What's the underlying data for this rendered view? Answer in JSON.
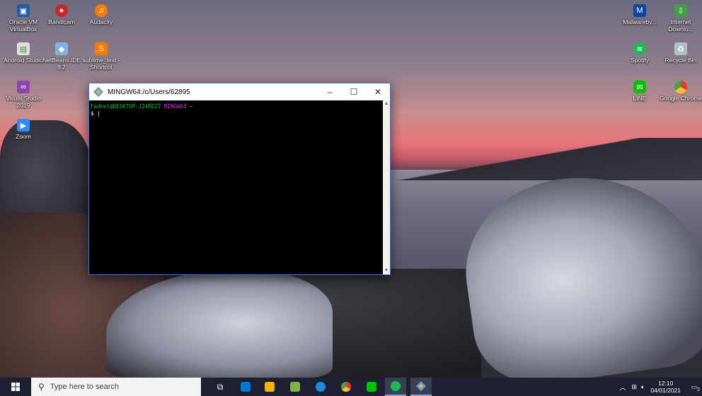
{
  "desktop_icons": [
    {
      "label": "Oracle VM VirtualBox",
      "icon": "virtualbox-icon",
      "color": "#1f5fa8"
    },
    {
      "label": "Bandicam",
      "icon": "bandicam-icon",
      "color": "#c62828"
    },
    {
      "label": "Audacity",
      "icon": "audacity-icon",
      "color": "#f57c00"
    },
    {
      "label": "Android Studio",
      "icon": "android-studio-icon",
      "color": "#e0e0e0"
    },
    {
      "label": "NetBeans IDE 8.2",
      "icon": "netbeans-icon",
      "color": "#7fb2e5"
    },
    {
      "label": "sublime_text - Shortcut",
      "icon": "sublime-icon",
      "color": "#ff7b00"
    },
    {
      "label": "Visual Studio 2019",
      "icon": "visual-studio-icon",
      "color": "#8e44ad"
    },
    {
      "label": "Zoom",
      "icon": "zoom-icon",
      "color": "#2d8cff"
    },
    {
      "label": "Malwareby...",
      "icon": "malwarebytes-icon",
      "color": "#0d47a1"
    },
    {
      "label": "Internet Downlo...",
      "icon": "idm-icon",
      "color": "#43a047"
    },
    {
      "label": "Spotify",
      "icon": "spotify-icon",
      "color": "#1db954"
    },
    {
      "label": "Recycle Bin",
      "icon": "recycle-bin-icon",
      "color": "#b0bec5"
    },
    {
      "label": "LINE",
      "icon": "line-icon",
      "color": "#00c300"
    },
    {
      "label": "Google Chrome",
      "icon": "chrome-icon",
      "color": "#e53935"
    }
  ],
  "terminal": {
    "title": "MINGW64:/c/Users/62895",
    "prompt_user": "Fadhel@DESKTOP-J24RE27",
    "prompt_env": "MINGW64",
    "prompt_path": "~",
    "prompt_symbol": "$",
    "minimize": "–",
    "maximize": "☐",
    "close": "✕"
  },
  "taskbar": {
    "search_placeholder": "Type here to search",
    "time": "12:10",
    "date": "04/01/2021",
    "notification_count": "2",
    "apps": [
      {
        "name": "task-view",
        "color": "#ffffff"
      },
      {
        "name": "mail",
        "color": "#0078d4"
      },
      {
        "name": "file-explorer",
        "color": "#f4b400"
      },
      {
        "name": "notepad",
        "color": "#7cb342"
      },
      {
        "name": "edge",
        "color": "#1e88e5"
      },
      {
        "name": "chrome",
        "color": "#e53935"
      },
      {
        "name": "line",
        "color": "#00c300"
      },
      {
        "name": "spotify",
        "color": "#1db954"
      },
      {
        "name": "git-bash",
        "color": "#5c9ad6"
      }
    ]
  }
}
